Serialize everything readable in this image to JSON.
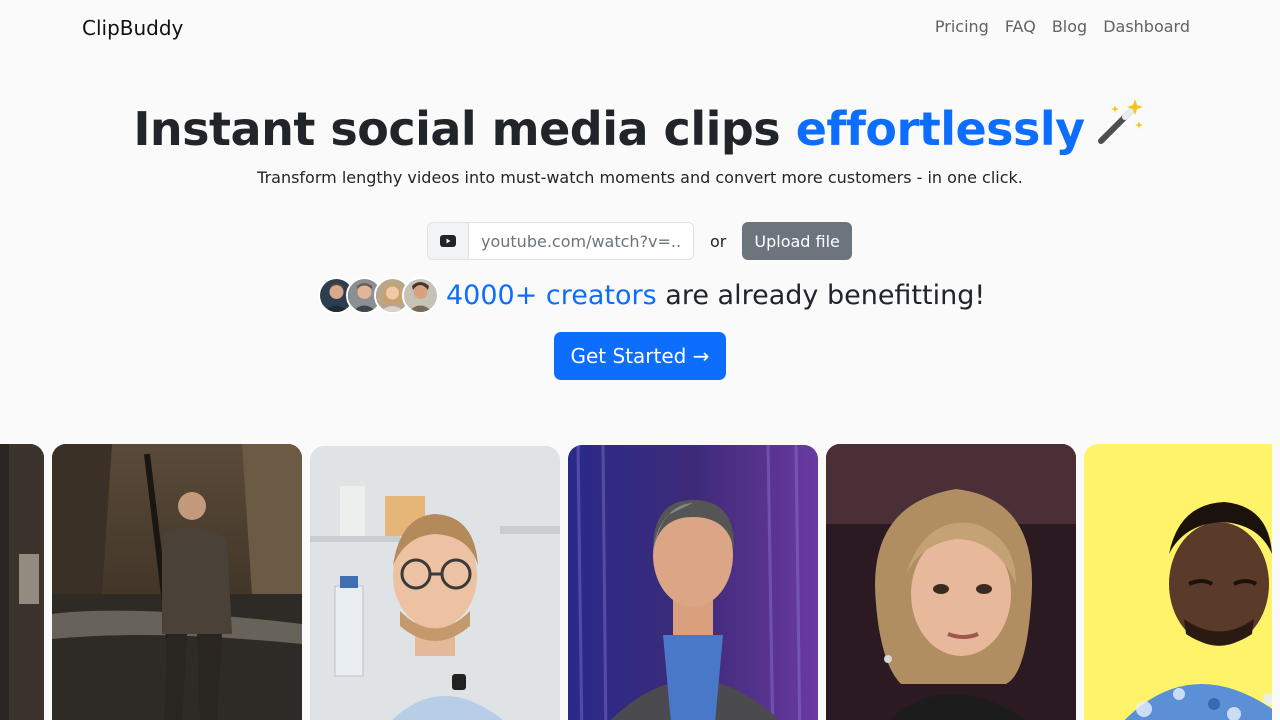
{
  "nav": {
    "brand": "ClipBuddy",
    "links": [
      "Pricing",
      "FAQ",
      "Blog",
      "Dashboard"
    ]
  },
  "hero": {
    "title_main": "Instant social media clips",
    "title_accent": "effortlessly",
    "subtitle": "Transform lengthy videos into must-watch moments and convert more customers - in one click."
  },
  "input": {
    "placeholder": "youtube.com/watch?v=..",
    "or": "or",
    "upload_label": "Upload file"
  },
  "social_proof": {
    "count": "4000+ creators",
    "text": "are already benefitting!"
  },
  "cta": {
    "label": "Get Started →"
  },
  "colors": {
    "accent": "#0d6efd",
    "secondary": "#6c757d",
    "background": "#fafafa"
  },
  "icons": [
    "youtube-icon",
    "magic-wand-icon"
  ]
}
